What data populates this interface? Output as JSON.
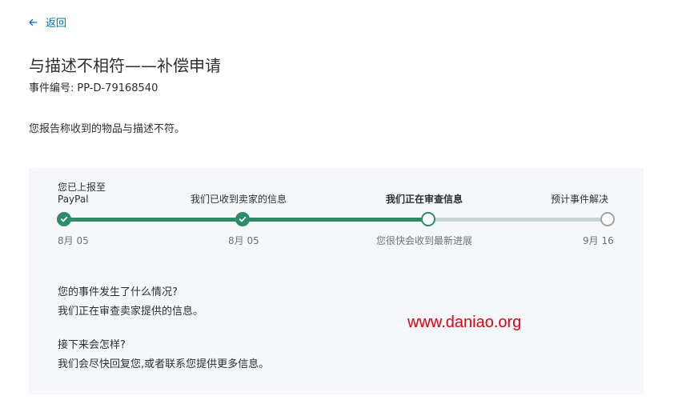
{
  "nav": {
    "back_label": "返回",
    "back_icon": "arrow-left-icon"
  },
  "header": {
    "title": "与描述不相符——补偿申请",
    "case_id_label": "事件编号:",
    "case_id_value": "PP-D-79168540"
  },
  "description": "您报告称收到的物品与描述不符。",
  "tracker": {
    "steps": [
      {
        "label": "您已上报至 PayPal",
        "date": "8月 05",
        "state": "done"
      },
      {
        "label": "我们已收到卖家的信息",
        "date": "8月 05",
        "state": "done"
      },
      {
        "label": "我们正在审查信息",
        "date": "您很快会收到最新进展",
        "state": "current"
      },
      {
        "label": "预计事件解决",
        "date": "9月 16",
        "state": "pending"
      }
    ],
    "colors": {
      "done": "#2e8b6a",
      "todo": "#cbd2d6"
    }
  },
  "info": {
    "what_happened_heading": "您的事件发生了什么情况?",
    "what_happened_text": "我们正在审查卖家提供的信息。",
    "next_heading": "接下来会怎样?",
    "next_text": "我们会尽快回复您,或者联系您提供更多信息。"
  },
  "watermark": "www.daniao.org"
}
